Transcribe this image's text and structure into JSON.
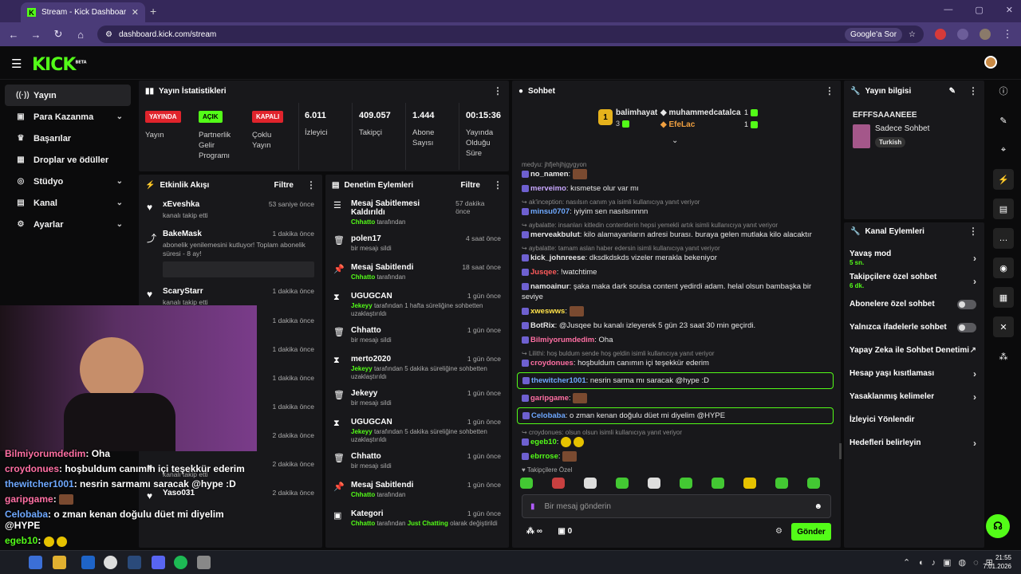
{
  "browser": {
    "tab_title": "Stream - Kick Dashboard",
    "url": "dashboard.kick.com/stream",
    "search_btn": "Google'a Sor"
  },
  "header": {
    "logo": "KICK",
    "beta": "BETA"
  },
  "sidebar": {
    "items": [
      {
        "label": "Yayın",
        "icon": "signal-icon"
      },
      {
        "label": "Para Kazanma",
        "icon": "money-icon"
      },
      {
        "label": "Başarılar",
        "icon": "trophy-icon"
      },
      {
        "label": "Droplar ve ödüller",
        "icon": "gift-icon"
      },
      {
        "label": "Stüdyo",
        "icon": "studio-icon"
      },
      {
        "label": "Kanal",
        "icon": "channel-icon"
      },
      {
        "label": "Ayarlar",
        "icon": "gear-icon"
      }
    ]
  },
  "stats": {
    "title": "Yayın İstatistikleri",
    "live_badge": "YAYINDA",
    "live_label": "Yayın",
    "partner_badge": "AÇIK",
    "partner_label": "Partnerlik Gelir Programı",
    "multi_badge": "KAPALI",
    "multi_label": "Çoklu Yayın",
    "viewers": "6.011",
    "viewers_label": "İzleyici",
    "followers": "409.057",
    "followers_label": "Takipçi",
    "subs": "1.444",
    "subs_label": "Abone Sayısı",
    "uptime": "00:15:36",
    "uptime_label": "Yayında Olduğu Süre"
  },
  "activity": {
    "title": "Etkinlik Akışı",
    "filter": "Filtre",
    "items": [
      {
        "name": "xEveshka",
        "time": "53 saniye önce",
        "desc": "kanalı takip etti"
      },
      {
        "name": "BakeMask",
        "time": "1 dakika önce",
        "desc": "abonelik yenilemesini kutluyor! Toplam abonelik süresi - 8 ay!"
      },
      {
        "name": "ScaryStarr",
        "time": "1 dakika önce",
        "desc": "kanalı takip etti"
      },
      {
        "name": "",
        "time": "1 dakika önce",
        "desc": ""
      },
      {
        "name": "",
        "time": "1 dakika önce",
        "desc": "Toplam abonelik"
      },
      {
        "name": "",
        "time": "1 dakika önce",
        "desc": ""
      },
      {
        "name": "",
        "time": "1 dakika önce",
        "desc": ""
      },
      {
        "name": "Achie17",
        "time": "2 dakika önce",
        "desc": ""
      },
      {
        "name": "",
        "time": "2 dakika önce",
        "desc": "kanalı takip etti"
      },
      {
        "name": "Yaso031",
        "time": "2 dakika önce",
        "desc": ""
      }
    ]
  },
  "moderation": {
    "title": "Denetim Eylemleri",
    "filter": "Filtre",
    "items": [
      {
        "name": "Mesaj Sabitlemesi Kaldırıldı",
        "time": "57 dakika önce",
        "actor": "Chhatto",
        "desc": "tarafından"
      },
      {
        "name": "polen17",
        "time": "4 saat önce",
        "actor": "",
        "desc": "bir mesajı sildi"
      },
      {
        "name": "Mesaj Sabitlendi",
        "time": "18 saat önce",
        "actor": "Chhatto",
        "desc": "tarafından"
      },
      {
        "name": "UGUGCAN",
        "time": "1 gün önce",
        "actor": "Jekeyy",
        "desc": "tarafından 1 hafta süreliğine sohbetten uzaklaştırıldı"
      },
      {
        "name": "Chhatto",
        "time": "1 gün önce",
        "actor": "",
        "desc": "bir mesajı sildi"
      },
      {
        "name": "merto2020",
        "time": "1 gün önce",
        "actor": "Jekeyy",
        "desc": "tarafından 5 dakika süreliğine sohbetten uzaklaştırıldı"
      },
      {
        "name": "Jekeyy",
        "time": "1 gün önce",
        "actor": "",
        "desc": "bir mesajı sildi"
      },
      {
        "name": "UGUGCAN",
        "time": "1 gün önce",
        "actor": "Jekeyy",
        "desc": "tarafından 5 dakika süreliğine sohbetten uzaklaştırıldı"
      },
      {
        "name": "Chhatto",
        "time": "1 gün önce",
        "actor": "",
        "desc": "bir mesajı sildi"
      },
      {
        "name": "Mesaj Sabitlendi",
        "time": "1 gün önce",
        "actor": "Chhatto",
        "desc": "tarafından"
      },
      {
        "name": "Kategori",
        "time": "1 gün önce",
        "actor": "Chhatto",
        "desc": "tarafından",
        "extra": "Just Chatting",
        "extra2": "olarak değiştirildi"
      }
    ]
  },
  "chat": {
    "title": "Sohbet",
    "top1_name": "balimhayat",
    "top1_count": "3",
    "top1_rank": "1",
    "top2_name": "muhammedcatalca",
    "top2_count": "1",
    "top3_name": "EfeLac",
    "top3_count": "1",
    "messages": [
      {
        "user": "",
        "text": "",
        "reply": "medyu: jhfjehjhjgygyon"
      },
      {
        "user": "no_namen",
        "text": ":",
        "color": "#e8e8e8"
      },
      {
        "user": "merveimo",
        "text": ": kısmetse olur var mı",
        "color": "#c9a8ff"
      },
      {
        "reply": "ak'inception: nasılsın canım ya isimli kullanıcıya yanıt veriyor"
      },
      {
        "user": "minsu0707",
        "text": ": iyiyim sen nasılsınnnn",
        "color": "#6ea8ff"
      },
      {
        "reply": "aybalatte: insanları kitledin contentlerin hepsi yemekli artık isimli kullanıcıya yanıt veriyor"
      },
      {
        "user": "merveakbulut",
        "text": ": kilo alamayanların adresi burası. buraya gelen mutlaka kilo alacaktır",
        "color": "#e8e8e8"
      },
      {
        "reply": "aybalatte: tamam aslan haber edersin isimli kullanıcıya yanıt veriyor"
      },
      {
        "user": "kick_johnreese",
        "text": ": dksdkdskds vizeler merakla bekeniyor",
        "color": "#e8e8e8"
      },
      {
        "user": "Jusqee",
        "text": ": !watchtime",
        "color": "#ff5b5b"
      },
      {
        "user": "namoainur",
        "text": ": şaka maka dark soulsa content yedirdi adam. helal olsun bambaşka bir seviye",
        "color": "#e8e8e8"
      },
      {
        "user": "xweswws",
        "text": ":",
        "color": "#ffe24a"
      },
      {
        "user": "BotRix",
        "text": ": @Jusqee bu kanalı izleyerek 5 gün 23 saat 30 min geçirdi.",
        "color": "#e8e8e8"
      },
      {
        "user": "Bilmiyorumdedim",
        "text": ": Oha",
        "color": "#ff6fa3"
      },
      {
        "reply": "Lilithi: hoş buldum sende hoş geldin isimli kullanıcıya yanıt veriyor"
      },
      {
        "user": "croydonues",
        "text": ": hoşbuldum canımın içi teşekkür ederim",
        "color": "#ff6fa3"
      },
      {
        "user": "thewitcher1001",
        "text": ": nesrin sarma mı saracak @hype :D",
        "color": "#6ea8ff",
        "hl": true
      },
      {
        "user": "garipgame",
        "text": ":",
        "color": "#ff6fa3"
      },
      {
        "user": "Celobaba",
        "text": ": o zman kenan doğulu düet mi diyelim @HYPE",
        "color": "#6ea8ff",
        "hl": true
      },
      {
        "reply": "croydonues: olsun olsun isimli kullanıcıya yanıt veriyor"
      },
      {
        "user": "egeb10",
        "text": ":",
        "color": "#53fc18"
      },
      {
        "user": "ebrrose",
        "text": ":",
        "color": "#53fc18"
      }
    ],
    "followers_only": "Takipçilere Özel",
    "placeholder": "Bir mesaj gönderin",
    "count": "0",
    "send": "Gönder"
  },
  "info": {
    "title": "Yayın bilgisi",
    "stream_title": "EFFFSAAANEEE",
    "category": "Sadece Sohbet",
    "tag": "Turkish"
  },
  "channel": {
    "title": "Kanal Eylemleri",
    "items": [
      {
        "label": "Yavaş mod",
        "sub": "5 sn.",
        "type": "chev"
      },
      {
        "label": "Takipçilere özel sohbet",
        "sub": "6 dk.",
        "type": "chev"
      },
      {
        "label": "Abonelere özel sohbet",
        "sub": "",
        "type": "toggle"
      },
      {
        "label": "Yalnızca ifadelerle sohbet",
        "sub": "",
        "type": "toggle"
      },
      {
        "label": "Yapay Zeka ile Sohbet Denetimi",
        "sub": "",
        "type": "ext"
      },
      {
        "label": "Hesap yaşı kısıtlaması",
        "sub": "",
        "type": "chev"
      },
      {
        "label": "Yasaklanmış kelimeler",
        "sub": "",
        "type": "chev"
      },
      {
        "label": "İzleyici Yönlendir",
        "sub": "",
        "type": "none"
      },
      {
        "label": "Hedefleri belirleyin",
        "sub": "",
        "type": "chev"
      }
    ]
  },
  "overlay": {
    "lines": [
      {
        "user": "Bilmiyorumdedim",
        "text": ": Oha",
        "color": "#ff6fa3"
      },
      {
        "user": "croydonues",
        "text": ": hoşbuldum canımın içi teşekkür ederim",
        "color": "#ff6fa3"
      },
      {
        "user": "thewitcher1001",
        "text": ": nesrin sarmamı saracak @hype :D",
        "color": "#6ea8ff"
      },
      {
        "user": "garipgame",
        "text": ":",
        "color": "#ff6fa3"
      },
      {
        "user": "Celobaba",
        "text": ": o zman kenan doğulu düet mi diyelim @HYPE",
        "color": "#6ea8ff"
      },
      {
        "user": "egeb10",
        "text": ":",
        "color": "#53fc18"
      },
      {
        "user": "ebrrose",
        "text": ":",
        "color": "#53fc18"
      }
    ]
  },
  "taskbar": {
    "time": "21:55",
    "date": "7.01.2026"
  },
  "colors": {
    "accent": "#53fc18",
    "panel": "#18181b",
    "bg": "#0b0b0c",
    "live": "#e0242c"
  }
}
